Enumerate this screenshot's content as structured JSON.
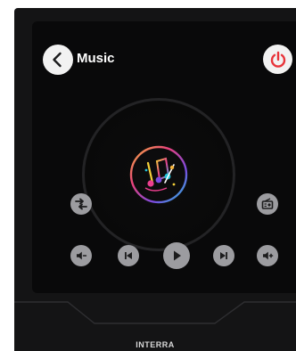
{
  "header": {
    "title": "Music",
    "back_icon": "chevron-left-icon",
    "power_icon": "power-icon",
    "power_color": "#e8343a"
  },
  "player": {
    "artwork_icon": "music-notes-icon",
    "shuffle_icon": "shuffle-icon",
    "radio_icon": "radio-icon",
    "controls": [
      "volume-down-icon",
      "previous-track-icon",
      "play-icon",
      "next-track-icon",
      "volume-up-icon"
    ]
  },
  "device": {
    "brand": "INTERRA"
  }
}
